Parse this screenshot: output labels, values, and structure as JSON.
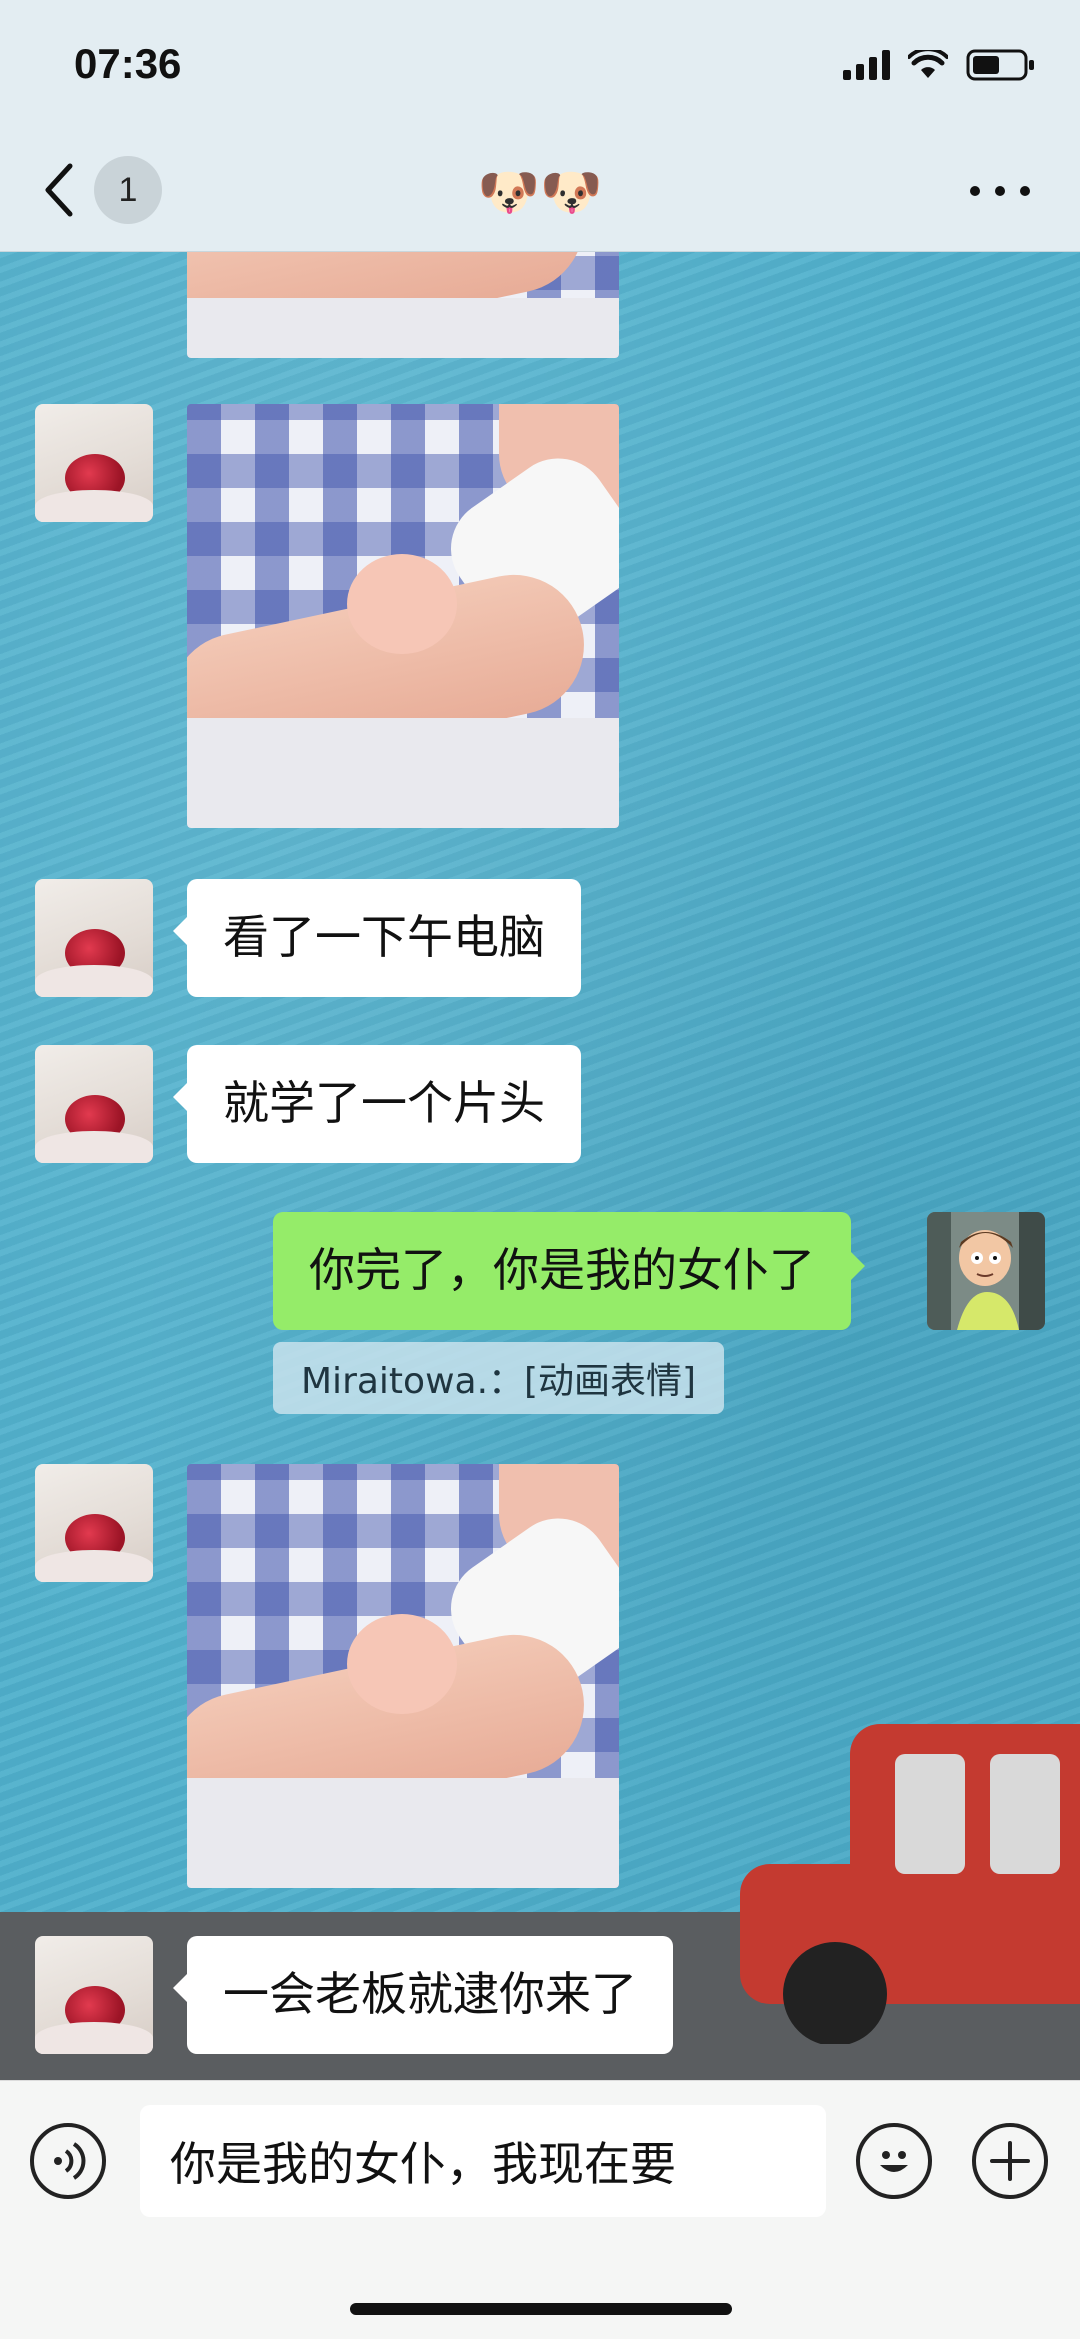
{
  "status": {
    "time": "07:36"
  },
  "header": {
    "unread_count": "1",
    "title": "🐶🐶"
  },
  "messages": [
    {
      "type": "image",
      "side": "left"
    },
    {
      "type": "image",
      "side": "left"
    },
    {
      "type": "text",
      "side": "left",
      "text": "看了一下午电脑"
    },
    {
      "type": "text",
      "side": "left",
      "text": "就学了一个片头"
    },
    {
      "type": "text",
      "side": "right",
      "text": "你完了，你是我的女仆了"
    },
    {
      "type": "quote",
      "text": "Miraitowa.：[动画表情]"
    },
    {
      "type": "image",
      "side": "left"
    },
    {
      "type": "text",
      "side": "left",
      "text": "一会老板就逮你来了"
    }
  ],
  "input": {
    "value": "你是我的女仆，我现在要"
  },
  "colors": {
    "chat_bg": "#4fb0cc",
    "my_bubble": "#95ec69",
    "their_bubble": "#ffffff"
  }
}
